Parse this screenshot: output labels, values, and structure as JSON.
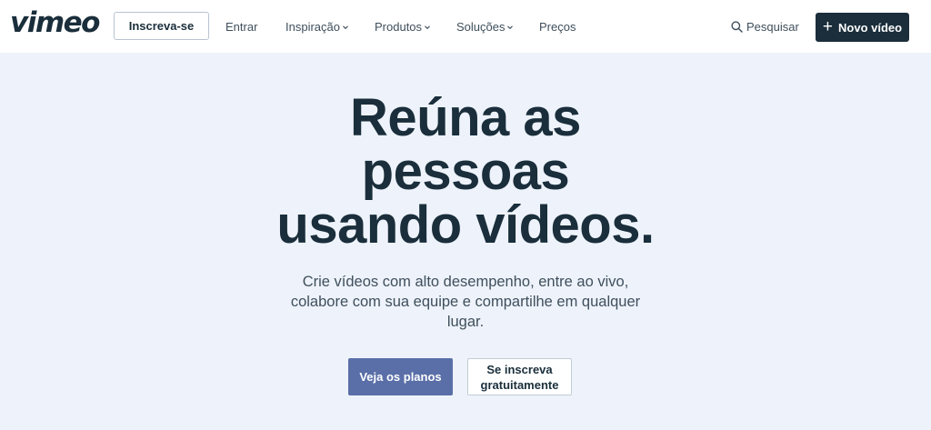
{
  "header": {
    "logo_text": "vimeo",
    "signup_label": "Inscreva-se",
    "nav": [
      {
        "label": "Entrar",
        "has_dropdown": false
      },
      {
        "label": "Inspiração",
        "has_dropdown": true
      },
      {
        "label": "Produtos",
        "has_dropdown": true
      },
      {
        "label": "Soluções",
        "has_dropdown": true
      },
      {
        "label": "Preços",
        "has_dropdown": false
      }
    ],
    "search_label": "Pesquisar",
    "new_video_label": "Novo vídeo"
  },
  "hero": {
    "title_lines": [
      "Reúna as",
      "pessoas",
      "usando vídeos."
    ],
    "subtitle": "Crie vídeos com alto desempenho, entre ao vivo, colabore com sua equipe e compartilhe em qualquer lugar.",
    "primary_cta": "Veja os planos",
    "secondary_cta": "Se inscreva gratuitamente"
  },
  "colors": {
    "background": "#eef3fb",
    "header_bg": "#ffffff",
    "text_dark": "#1a2e3b",
    "primary_button": "#5a6fa8",
    "dark_button": "#1a2e3b"
  },
  "icons": {
    "search": "search-icon",
    "plus": "plus-icon",
    "dropdown": "chevron-down-icon"
  }
}
